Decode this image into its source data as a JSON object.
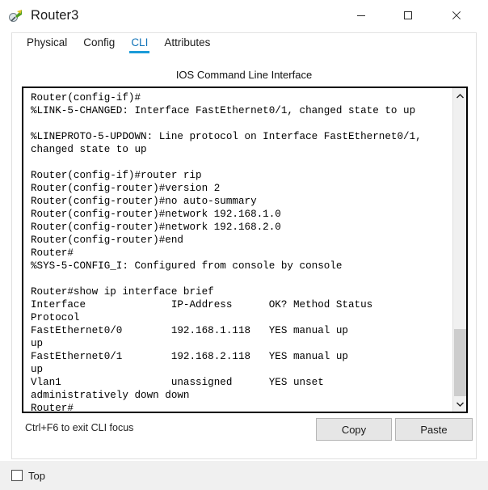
{
  "window": {
    "title": "Router3",
    "icon": "router-device-icon",
    "controls": {
      "minimize": "minimize-icon",
      "maximize": "maximize-icon",
      "close": "close-icon"
    }
  },
  "tabs": [
    {
      "label": "Physical",
      "active": false
    },
    {
      "label": "Config",
      "active": false
    },
    {
      "label": "CLI",
      "active": true
    },
    {
      "label": "Attributes",
      "active": false
    }
  ],
  "cli": {
    "header": "IOS Command Line Interface",
    "lines": [
      "Router(config-if)#",
      "%LINK-5-CHANGED: Interface FastEthernet0/1, changed state to up",
      "",
      "%LINEPROTO-5-UPDOWN: Line protocol on Interface FastEthernet0/1,",
      "changed state to up",
      "",
      "Router(config-if)#router rip",
      "Router(config-router)#version 2",
      "Router(config-router)#no auto-summary",
      "Router(config-router)#network 192.168.1.0",
      "Router(config-router)#network 192.168.2.0",
      "Router(config-router)#end",
      "Router#",
      "%SYS-5-CONFIG_I: Configured from console by console",
      "",
      "Router#show ip interface brief",
      "Interface              IP-Address      OK? Method Status",
      "Protocol",
      "FastEthernet0/0        192.168.1.118   YES manual up",
      "up",
      "FastEthernet0/1        192.168.2.118   YES manual up",
      "up",
      "Vlan1                  unassigned      YES unset",
      "administratively down down",
      "Router#"
    ],
    "scrollbar": {
      "up_arrow": "chevron-up-icon",
      "down_arrow": "chevron-down-icon"
    }
  },
  "footer": {
    "hint": "Ctrl+F6 to exit CLI focus",
    "copy_label": "Copy",
    "paste_label": "Paste"
  },
  "bottom": {
    "top_label": "Top",
    "top_checked": false
  },
  "colors": {
    "accent": "#1b9bd8",
    "active_tab_text": "#1173b8",
    "terminal_bg": "#ffffff",
    "terminal_text": "#000000",
    "button_face": "#e6e6e6",
    "chrome": "#f0f0f0"
  }
}
